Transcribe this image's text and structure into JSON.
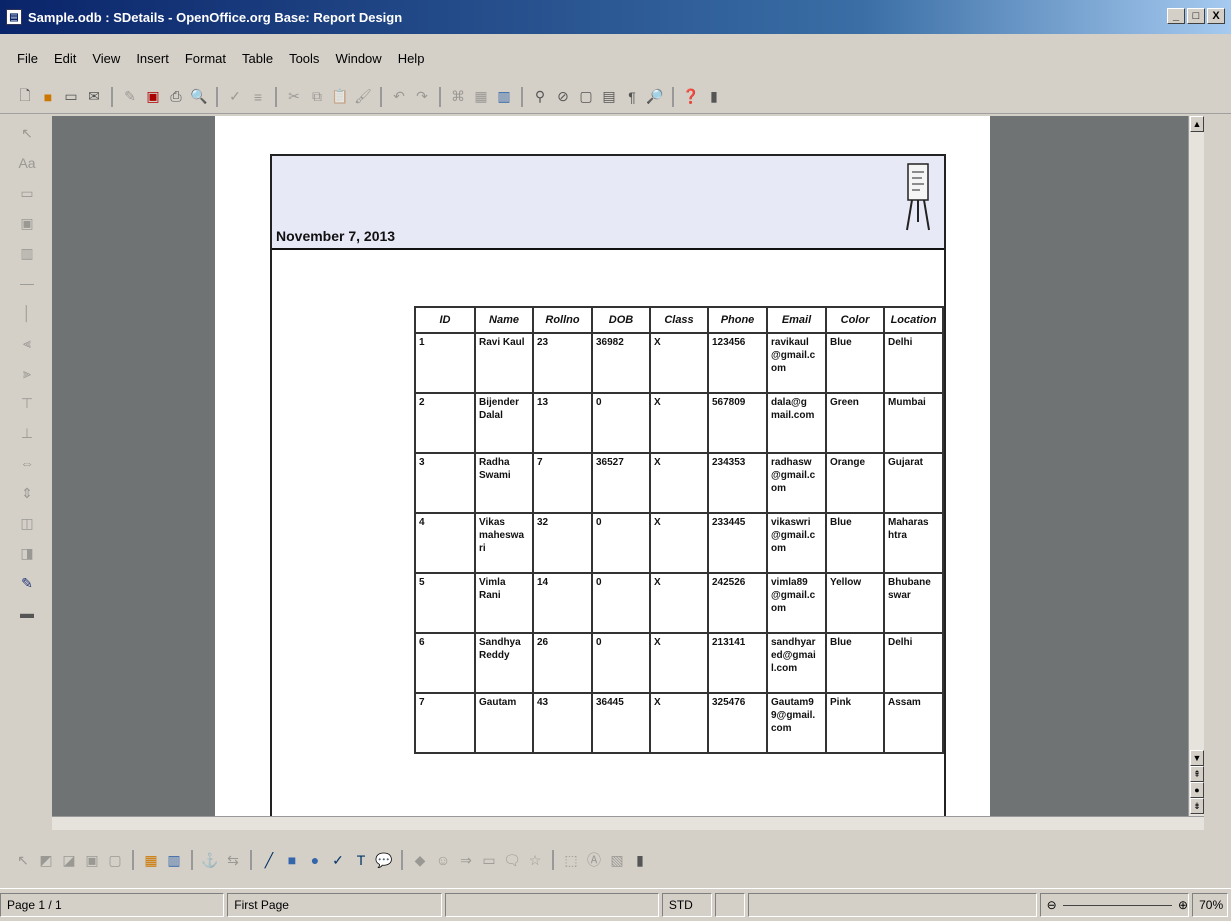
{
  "window": {
    "title": "Sample.odb : SDetails - OpenOffice.org Base: Report Design",
    "btn_min": "_",
    "btn_max": "□",
    "btn_close": "X"
  },
  "menu": [
    "File",
    "Edit",
    "View",
    "Insert",
    "Format",
    "Table",
    "Tools",
    "Window",
    "Help"
  ],
  "report": {
    "date": "November 7, 2013",
    "columns": [
      "ID",
      "Name",
      "Rollno",
      "DOB",
      "Class",
      "Phone",
      "Email",
      "Color",
      "Location"
    ],
    "rows": [
      [
        "1",
        "Ravi Kaul",
        "23",
        "36982",
        "X",
        "123456",
        "ravikaul\n@gmail.c\nom",
        "Blue",
        "Delhi"
      ],
      [
        "2",
        "Bijender\nDalal",
        "13",
        "0",
        "X",
        "567809",
        "dala@g\nmail.com",
        "Green",
        "Mumbai"
      ],
      [
        "3",
        "Radha\nSwami",
        "7",
        "36527",
        "X",
        "234353",
        "radhasw\n@gmail.c\nom",
        "Orange",
        "Gujarat"
      ],
      [
        "4",
        "Vikas\nmaheswa\nri",
        "32",
        "0",
        "X",
        "233445",
        "vikaswri\n@gmail.c\nom",
        "Blue",
        "Maharas\nhtra"
      ],
      [
        "5",
        "Vimla\nRani",
        "14",
        "0",
        "X",
        "242526",
        "vimla89\n@gmail.c\nom",
        "Yellow",
        "Bhubane\nswar"
      ],
      [
        "6",
        "Sandhya\nReddy",
        "26",
        "0",
        "X",
        "213141",
        "sandhyar\ned@gmai\nl.com",
        "Blue",
        "Delhi"
      ],
      [
        "7",
        "Gautam",
        "43",
        "36445",
        "X",
        "325476",
        "Gautam9\n9@gmail.\ncom",
        "Pink",
        "Assam"
      ]
    ]
  },
  "status": {
    "page": "Page 1 / 1",
    "style": "First Page",
    "mode": "STD",
    "zoom": "70%"
  },
  "colors": {
    "titlebar": "#0a246a",
    "canvas": "#6f7374",
    "report_header": "#e8e9f7"
  }
}
